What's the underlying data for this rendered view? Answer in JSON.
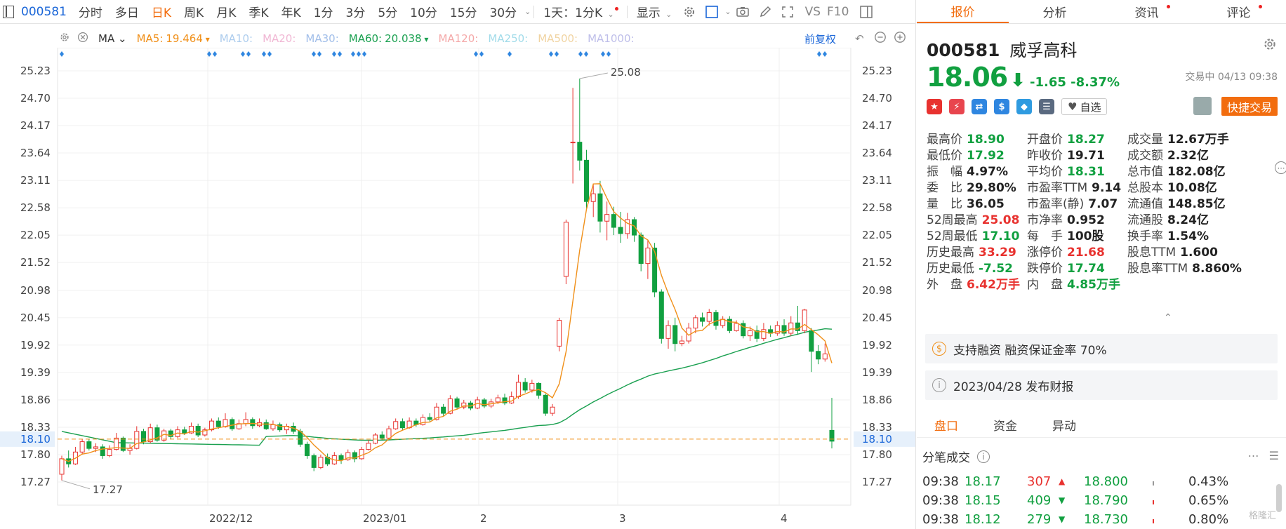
{
  "toolbar": {
    "code": "000581",
    "periods": [
      "分时",
      "多日",
      "日K",
      "周K",
      "月K",
      "季K",
      "年K",
      "1分",
      "3分",
      "5分",
      "10分",
      "15分",
      "30分"
    ],
    "active_period": "日K",
    "range": "1天：1分K",
    "display": "显示",
    "vs": "VS",
    "f10": "F10"
  },
  "ma_row": {
    "label": "MA",
    "items": [
      {
        "text": "MA5:",
        "value": "19.464",
        "color": "#f0901a",
        "dim": false,
        "arrow": true
      },
      {
        "text": "MA10:",
        "value": "",
        "color": "#4a90d9",
        "dim": true
      },
      {
        "text": "MA20:",
        "value": "",
        "color": "#e060a0",
        "dim": true
      },
      {
        "text": "MA30:",
        "value": "",
        "color": "#3070d0",
        "dim": true
      },
      {
        "text": "MA60:",
        "value": "20.038",
        "color": "#1aa050",
        "dim": false,
        "arrow": true
      },
      {
        "text": "MA120:",
        "value": "",
        "color": "#e84040",
        "dim": true
      },
      {
        "text": "MA250:",
        "value": "",
        "color": "#30b0d0",
        "dim": true
      },
      {
        "text": "MA500:",
        "value": "",
        "color": "#e0a030",
        "dim": true
      },
      {
        "text": "MA1000:",
        "value": "",
        "color": "#7070d0",
        "dim": true
      }
    ],
    "adjust": "前复权"
  },
  "chart_data": {
    "type": "candlestick",
    "y_ticks": [
      "25.23",
      "24.70",
      "24.17",
      "23.64",
      "23.11",
      "22.58",
      "22.05",
      "21.52",
      "20.98",
      "20.45",
      "19.92",
      "19.39",
      "18.86",
      "18.33",
      "17.80",
      "17.27"
    ],
    "ylim": [
      17.0,
      25.5
    ],
    "x_labels": [
      "2022/12",
      "2023/01",
      "2",
      "3",
      "4"
    ],
    "current_price_label": "18.10",
    "current_price": 18.1,
    "max_label": "25.08",
    "min_label": "17.27",
    "candles": [
      [
        17.42,
        17.72,
        17.3,
        17.78
      ],
      [
        17.72,
        17.62,
        17.55,
        17.88
      ],
      [
        17.62,
        17.85,
        17.6,
        17.95
      ],
      [
        17.85,
        18.05,
        17.8,
        18.1
      ],
      [
        18.05,
        17.92,
        17.88,
        18.1
      ],
      [
        17.92,
        17.95,
        17.85,
        18.02
      ],
      [
        17.95,
        17.78,
        17.72,
        18.0
      ],
      [
        17.78,
        17.9,
        17.75,
        17.98
      ],
      [
        17.9,
        18.12,
        17.88,
        18.22
      ],
      [
        18.12,
        17.88,
        17.85,
        18.15
      ],
      [
        17.88,
        17.92,
        17.8,
        18.0
      ],
      [
        17.92,
        18.25,
        17.9,
        18.35
      ],
      [
        18.25,
        18.05,
        18.0,
        18.3
      ],
      [
        18.05,
        18.32,
        18.02,
        18.4
      ],
      [
        18.32,
        18.08,
        18.05,
        18.38
      ],
      [
        18.08,
        18.26,
        18.05,
        18.3
      ],
      [
        18.26,
        18.15,
        18.1,
        18.3
      ],
      [
        18.15,
        18.28,
        18.12,
        18.35
      ],
      [
        18.28,
        18.22,
        18.18,
        18.34
      ],
      [
        18.22,
        18.35,
        18.2,
        18.42
      ],
      [
        18.35,
        18.18,
        18.14,
        18.4
      ],
      [
        18.18,
        18.28,
        18.15,
        18.32
      ],
      [
        18.28,
        18.45,
        18.25,
        18.5
      ],
      [
        18.45,
        18.34,
        18.3,
        18.52
      ],
      [
        18.34,
        18.48,
        18.32,
        18.6
      ],
      [
        18.48,
        18.3,
        18.26,
        18.52
      ],
      [
        18.3,
        18.4,
        18.28,
        18.48
      ],
      [
        18.4,
        18.48,
        18.35,
        18.62
      ],
      [
        18.48,
        18.36,
        18.3,
        18.52
      ],
      [
        18.36,
        18.42,
        18.33,
        18.5
      ],
      [
        18.42,
        18.3,
        18.28,
        18.48
      ],
      [
        18.3,
        18.38,
        18.26,
        18.46
      ],
      [
        18.38,
        18.28,
        18.24,
        18.42
      ],
      [
        18.28,
        18.35,
        18.2,
        18.4
      ],
      [
        18.35,
        18.25,
        18.2,
        18.42
      ],
      [
        18.25,
        18.0,
        17.95,
        18.3
      ],
      [
        18.0,
        17.78,
        17.72,
        18.05
      ],
      [
        17.78,
        17.55,
        17.48,
        17.82
      ],
      [
        17.55,
        17.75,
        17.52,
        17.8
      ],
      [
        17.75,
        17.62,
        17.58,
        17.82
      ],
      [
        17.62,
        17.78,
        17.6,
        17.85
      ],
      [
        17.78,
        17.7,
        17.62,
        17.82
      ],
      [
        17.7,
        17.84,
        17.68,
        17.9
      ],
      [
        17.84,
        17.72,
        17.65,
        17.88
      ],
      [
        17.72,
        17.9,
        17.7,
        17.95
      ],
      [
        17.9,
        18.02,
        17.88,
        18.08
      ],
      [
        18.02,
        18.18,
        18.0,
        18.22
      ],
      [
        18.18,
        18.12,
        18.08,
        18.25
      ],
      [
        18.12,
        18.3,
        18.1,
        18.36
      ],
      [
        18.3,
        18.44,
        18.28,
        18.5
      ],
      [
        18.44,
        18.32,
        18.28,
        18.5
      ],
      [
        18.32,
        18.45,
        18.3,
        18.52
      ],
      [
        18.45,
        18.38,
        18.34,
        18.5
      ],
      [
        18.38,
        18.52,
        18.36,
        18.58
      ],
      [
        18.52,
        18.48,
        18.44,
        18.6
      ],
      [
        18.48,
        18.72,
        18.46,
        18.8
      ],
      [
        18.72,
        18.6,
        18.55,
        18.78
      ],
      [
        18.6,
        18.88,
        18.58,
        18.95
      ],
      [
        18.88,
        18.72,
        18.68,
        18.92
      ],
      [
        18.72,
        18.8,
        18.68,
        18.86
      ],
      [
        18.8,
        18.7,
        18.66,
        18.84
      ],
      [
        18.7,
        18.86,
        18.68,
        18.92
      ],
      [
        18.86,
        18.74,
        18.7,
        18.9
      ],
      [
        18.74,
        18.82,
        18.7,
        18.88
      ],
      [
        18.82,
        18.9,
        18.78,
        18.96
      ],
      [
        18.9,
        18.8,
        18.76,
        18.98
      ],
      [
        18.8,
        18.92,
        18.78,
        19.02
      ],
      [
        18.92,
        19.2,
        18.88,
        19.35
      ],
      [
        19.2,
        19.05,
        19.0,
        19.28
      ],
      [
        19.05,
        19.18,
        19.0,
        19.25
      ],
      [
        19.18,
        18.95,
        18.88,
        19.2
      ],
      [
        18.95,
        18.6,
        18.55,
        18.98
      ],
      [
        18.6,
        18.72,
        18.55,
        18.78
      ],
      [
        19.9,
        20.4,
        19.8,
        20.45
      ],
      [
        21.25,
        22.3,
        21.1,
        22.35
      ],
      [
        23.85,
        23.85,
        23.05,
        24.9
      ],
      [
        23.85,
        23.5,
        23.3,
        25.08
      ],
      [
        23.5,
        22.7,
        22.55,
        23.7
      ],
      [
        22.7,
        22.85,
        22.4,
        23.05
      ],
      [
        22.85,
        22.32,
        22.1,
        23.1
      ],
      [
        22.32,
        22.45,
        21.95,
        22.7
      ],
      [
        22.45,
        22.2,
        22.05,
        22.6
      ],
      [
        22.2,
        22.08,
        21.9,
        22.5
      ],
      [
        22.08,
        22.35,
        21.98,
        22.48
      ],
      [
        22.35,
        22.05,
        21.92,
        22.4
      ],
      [
        22.05,
        21.5,
        21.35,
        22.1
      ],
      [
        21.5,
        21.8,
        21.2,
        21.95
      ],
      [
        21.8,
        20.95,
        20.85,
        21.9
      ],
      [
        20.95,
        20.05,
        19.95,
        21.0
      ],
      [
        20.05,
        20.3,
        19.85,
        20.4
      ],
      [
        20.3,
        19.95,
        19.8,
        20.45
      ],
      [
        19.95,
        20.0,
        19.9,
        20.1
      ],
      [
        20.0,
        20.25,
        19.95,
        20.35
      ],
      [
        20.25,
        20.45,
        20.15,
        20.5
      ],
      [
        20.45,
        20.38,
        20.28,
        20.55
      ],
      [
        20.38,
        20.55,
        20.3,
        20.62
      ],
      [
        20.55,
        20.3,
        20.22,
        20.6
      ],
      [
        20.3,
        20.42,
        20.25,
        20.48
      ],
      [
        20.42,
        20.2,
        20.15,
        20.48
      ],
      [
        20.2,
        20.34,
        20.18,
        20.4
      ],
      [
        20.34,
        20.1,
        20.05,
        20.4
      ],
      [
        20.1,
        20.2,
        20.0,
        20.28
      ],
      [
        20.2,
        20.05,
        19.98,
        20.3
      ],
      [
        20.05,
        20.22,
        20.0,
        20.35
      ],
      [
        20.22,
        20.15,
        20.08,
        20.3
      ],
      [
        20.15,
        20.3,
        20.1,
        20.38
      ],
      [
        20.3,
        20.15,
        20.1,
        20.42
      ],
      [
        20.15,
        20.35,
        20.1,
        20.48
      ],
      [
        20.35,
        20.2,
        20.12,
        20.68
      ],
      [
        20.2,
        20.6,
        20.15,
        20.62
      ],
      [
        20.2,
        19.8,
        19.4,
        20.25
      ],
      [
        19.8,
        19.65,
        19.55,
        19.92
      ],
      [
        19.65,
        19.75,
        19.6,
        19.95
      ],
      [
        18.27,
        18.06,
        17.92,
        18.9
      ]
    ]
  },
  "quote": {
    "code": "000581",
    "name": "威孚高科",
    "price": "18.06",
    "arrow": "⬇",
    "change": "-1.65",
    "change_pct": "-8.37%",
    "status": "交易中 04/13 09:38",
    "watch_label": "自选",
    "quick_trade": "快捷交易"
  },
  "right_tabs": [
    {
      "label": "报价",
      "dot": false
    },
    {
      "label": "分析",
      "dot": false
    },
    {
      "label": "资讯",
      "dot": true
    },
    {
      "label": "评论",
      "dot": true
    }
  ],
  "stats": [
    [
      {
        "label": "最高价",
        "value": "18.90",
        "color": "green"
      },
      {
        "label": "开盘价",
        "value": "18.27",
        "color": "green"
      },
      {
        "label": "成交量",
        "value": "12.67万手",
        "color": "dark"
      }
    ],
    [
      {
        "label": "最低价",
        "value": "17.92",
        "color": "green"
      },
      {
        "label": "昨收价",
        "value": "19.71",
        "color": "dark"
      },
      {
        "label": "成交额",
        "value": "2.32亿",
        "color": "dark"
      }
    ],
    [
      {
        "label": "振　幅",
        "value": "4.97%",
        "color": "dark"
      },
      {
        "label": "平均价",
        "value": "18.31",
        "color": "green"
      },
      {
        "label": "总市值",
        "value": "182.08亿",
        "color": "dark"
      }
    ],
    [
      {
        "label": "委　比",
        "value": "29.80%",
        "color": "dark"
      },
      {
        "label": "市盈率TTM",
        "value": "9.14",
        "color": "dark"
      },
      {
        "label": "总股本",
        "value": "10.08亿",
        "color": "dark"
      }
    ],
    [
      {
        "label": "量　比",
        "value": "36.05",
        "color": "dark"
      },
      {
        "label": "市盈率(静)",
        "value": "7.07",
        "color": "dark"
      },
      {
        "label": "流通值",
        "value": "148.85亿",
        "color": "dark"
      }
    ],
    [
      {
        "label": "52周最高",
        "value": "25.08",
        "color": "red"
      },
      {
        "label": "市净率",
        "value": "0.952",
        "color": "dark"
      },
      {
        "label": "流通股",
        "value": "8.24亿",
        "color": "dark"
      }
    ],
    [
      {
        "label": "52周最低",
        "value": "17.10",
        "color": "green"
      },
      {
        "label": "每　手",
        "value": "100股",
        "color": "dark"
      },
      {
        "label": "换手率",
        "value": "1.54%",
        "color": "dark"
      }
    ],
    [
      {
        "label": "历史最高",
        "value": "33.29",
        "color": "red"
      },
      {
        "label": "涨停价",
        "value": "21.68",
        "color": "red"
      },
      {
        "label": "股息TTM",
        "value": "1.600",
        "color": "dark"
      }
    ],
    [
      {
        "label": "历史最低",
        "value": "-7.52",
        "color": "green"
      },
      {
        "label": "跌停价",
        "value": "17.74",
        "color": "green"
      },
      {
        "label": "股息率TTM",
        "value": "8.860%",
        "color": "dark"
      }
    ],
    [
      {
        "label": "外　盘",
        "value": "6.42万手",
        "color": "red"
      },
      {
        "label": "内　盘",
        "value": "4.85万手",
        "color": "green"
      }
    ]
  ],
  "margin_info": "支持融资 融资保证金率 70%",
  "report_info": "2023/04/28  发布财报",
  "sub_tabs": [
    "盘口",
    "资金",
    "异动"
  ],
  "ticks_title": "分笔成交",
  "ticks": [
    {
      "time": "09:38",
      "price": "18.17",
      "vol": "307",
      "dir": "up",
      "price2": "18.800",
      "pct": "0.43%"
    },
    {
      "time": "09:38",
      "price": "18.15",
      "vol": "409",
      "dir": "down",
      "price2": "18.790",
      "pct": "0.65%"
    },
    {
      "time": "09:38",
      "price": "18.12",
      "vol": "279",
      "dir": "down",
      "price2": "18.730",
      "pct": "0.80%"
    }
  ],
  "watermark": "格隆汇"
}
